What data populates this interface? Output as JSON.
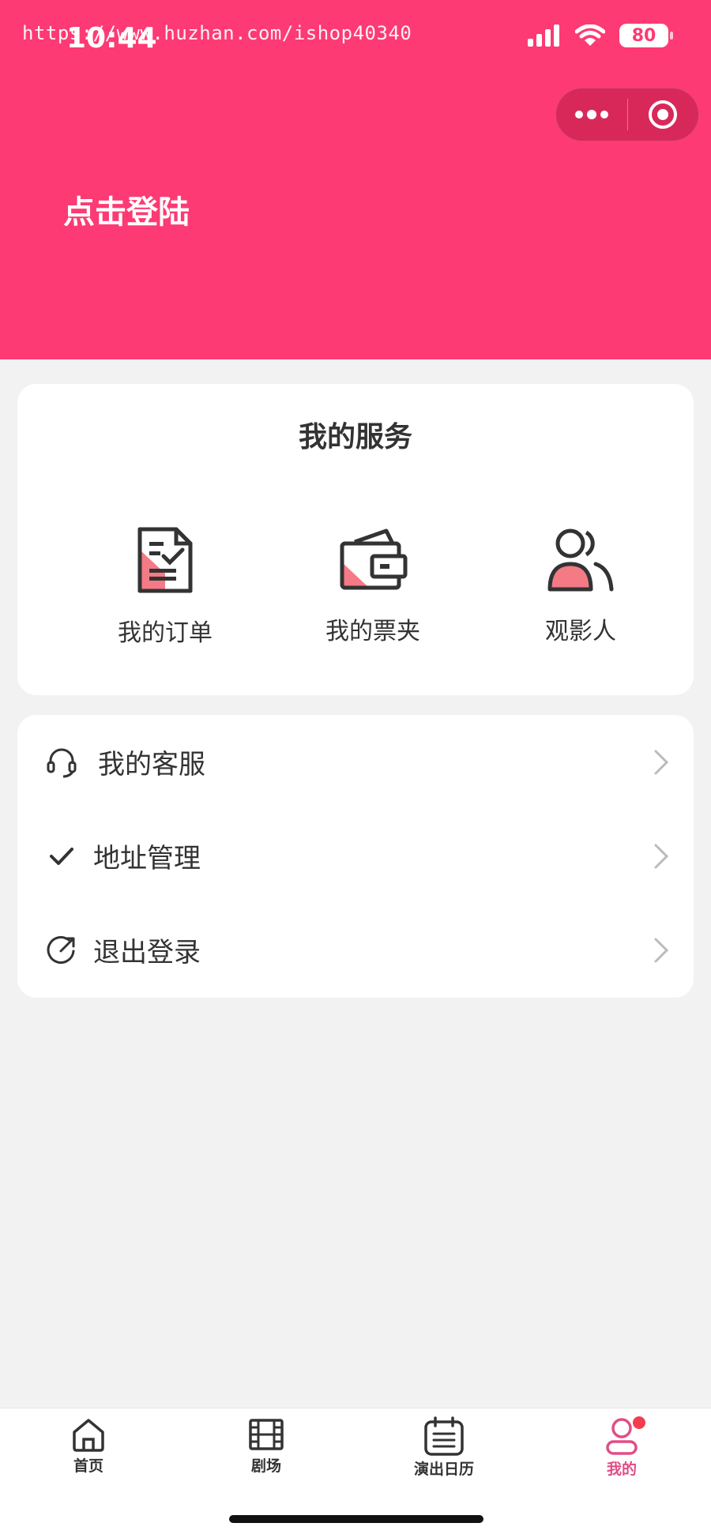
{
  "status_bar": {
    "time": "10:44",
    "battery": "80",
    "watermark": "https://www.huzhan.com/ishop40340"
  },
  "header": {
    "login_text": "点击登陆",
    "bg_color": "#fd3a73"
  },
  "services": {
    "title": "我的服务",
    "items": [
      {
        "label": "我的订单",
        "icon": "order-document-icon"
      },
      {
        "label": "我的票夹",
        "icon": "ticket-wallet-icon"
      },
      {
        "label": "观影人",
        "icon": "viewers-people-icon"
      }
    ]
  },
  "menu": {
    "items": [
      {
        "label": "我的客服",
        "icon": "headset-icon"
      },
      {
        "label": "地址管理",
        "icon": "check-icon"
      },
      {
        "label": "退出登录",
        "icon": "logout-icon"
      }
    ]
  },
  "tabbar": {
    "items": [
      {
        "label": "首页",
        "icon": "home-icon"
      },
      {
        "label": "剧场",
        "icon": "film-icon"
      },
      {
        "label": "演出日历",
        "icon": "calendar-icon"
      },
      {
        "label": "我的",
        "icon": "profile-icon",
        "active": true
      }
    ],
    "active_color": "#e24d86"
  }
}
